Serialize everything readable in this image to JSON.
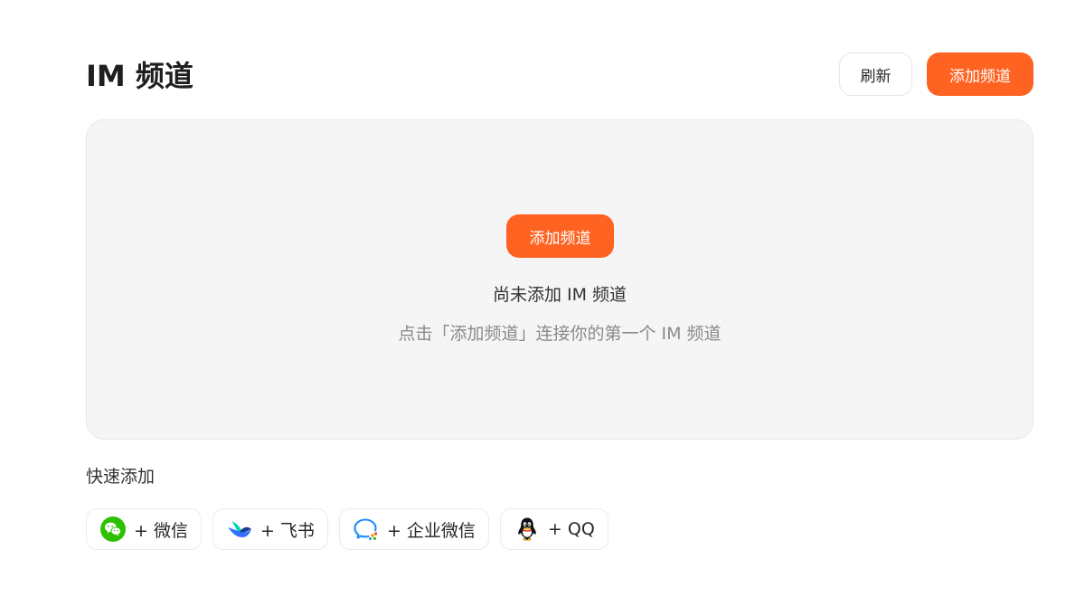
{
  "header": {
    "title": "IM 频道",
    "refresh_label": "刷新",
    "add_label": "添加频道"
  },
  "empty_state": {
    "add_label": "添加频道",
    "title": "尚未添加 IM 频道",
    "subtitle": "点击「添加频道」连接你的第一个 IM 频道"
  },
  "quick_add": {
    "label": "快速添加",
    "items": [
      {
        "label": "+ 微信",
        "icon": "wechat-icon"
      },
      {
        "label": "+ 飞书",
        "icon": "feishu-icon"
      },
      {
        "label": "+ 企业微信",
        "icon": "wecom-icon"
      },
      {
        "label": "+ QQ",
        "icon": "qq-icon"
      }
    ]
  },
  "colors": {
    "accent": "#ff6322",
    "panel_bg": "#f5f5f5",
    "wechat": "#2dc100",
    "feishu_blue": "#3370ff",
    "feishu_teal": "#00d6b9"
  }
}
